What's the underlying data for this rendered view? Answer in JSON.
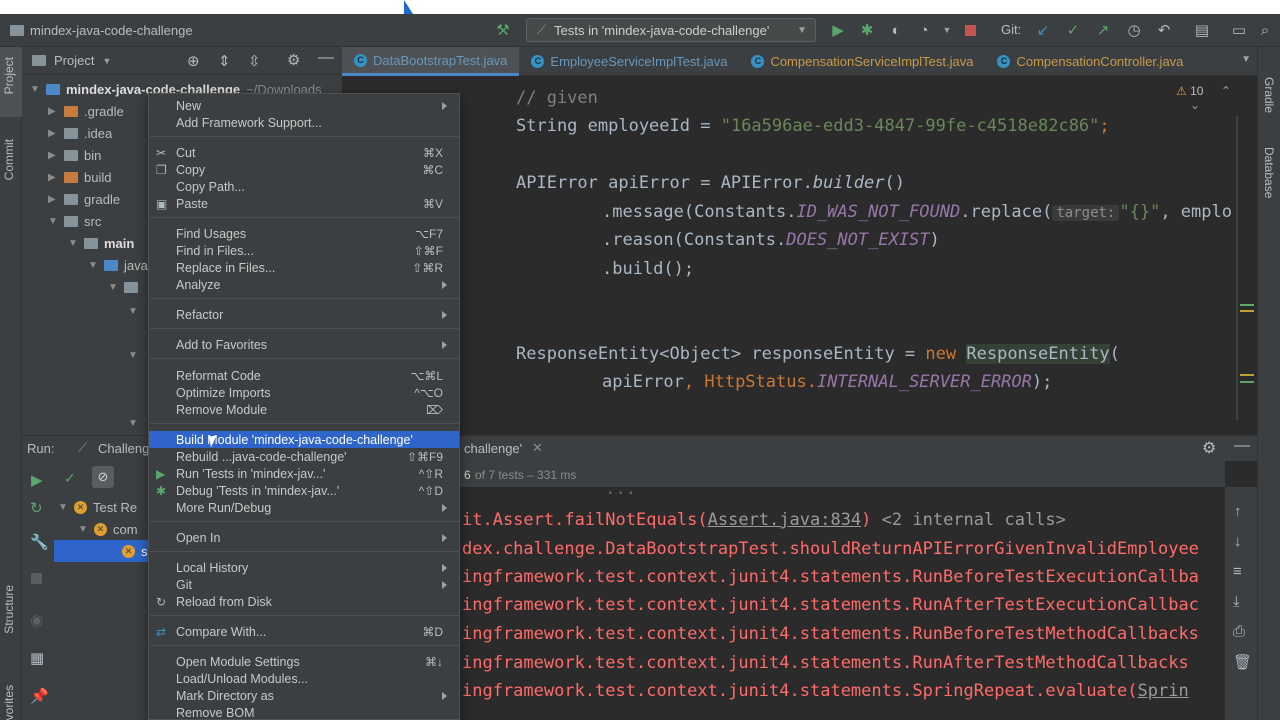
{
  "toolbar": {
    "project_name": "mindex-java-code-challenge",
    "run_config": "Tests in 'mindex-java-code-challenge'",
    "git_label": "Git:"
  },
  "left_strip": {
    "project": "Project",
    "commit": "Commit",
    "structure": "Structure",
    "favorites": "Favorites"
  },
  "right_strip": {
    "gradle": "Gradle",
    "database": "Database"
  },
  "project_panel": {
    "title": "Project",
    "root": "mindex-java-code-challenge",
    "root_path": "~/Downloads",
    "items": [
      ".gradle",
      ".idea",
      "bin",
      "build",
      "gradle",
      "src",
      "main",
      "java"
    ]
  },
  "tabs": [
    {
      "label": "DataBootstrapTest.java",
      "active": true
    },
    {
      "label": "EmployeeServiceImplTest.java",
      "active": false
    },
    {
      "label": "CompensationServiceImplTest.java",
      "active": false
    },
    {
      "label": "CompensationController.java",
      "active": false
    }
  ],
  "editor": {
    "warning_count": "10",
    "comment": "// given",
    "line1_type": "String employeeId = ",
    "line1_value": "\"16a596ae-edd3-4847-99fe-c4518e82c86\"",
    "line1_end": ";",
    "line2": "APIError apiError = APIError.",
    "line2_method": "builder",
    "line2_end": "()",
    "line3_a": ".message(Constants.",
    "line3_const": "ID_WAS_NOT_FOUND",
    "line3_b": ".replace(",
    "line3_hint": "target:",
    "line3_str": "\"{}\"",
    "line3_c": ", emplo",
    "line4_a": ".reason(Constants.",
    "line4_const": "DOES_NOT_EXIST",
    "line4_b": ")",
    "line5": ".build();",
    "line6_a": "ResponseEntity<Object> responseEntity = ",
    "line6_new": "new",
    "line6_b": "ResponseEntity",
    "line6_c": "(",
    "line7_a": "apiError",
    "line7_b": ", HttpStatus.",
    "line7_const": "INTERNAL_SERVER_ERROR",
    "line7_c": ");"
  },
  "run": {
    "label": "Run:",
    "config": "Challeng",
    "config_tail": "challenge'",
    "status_prefix": "6",
    "status_text": "of 7 tests – 331 ms",
    "tree_root": "Test Re",
    "tree_child": "com",
    "tree_leaf": "s",
    "console": [
      {
        "pre": "",
        "main": "it.Assert.failNotEquals(",
        "link": "Assert.java:834",
        "post": ")",
        "grey": " <2 internal calls>"
      },
      {
        "pre": "",
        "main": "dex.challenge.DataBootstrapTest.shouldReturnAPIErrorGivenInvalidEmployee",
        "link": "",
        "post": "",
        "grey": ""
      },
      {
        "pre": "",
        "main": "ingframework.test.context.junit4.statements.RunBeforeTestExecutionCallba",
        "link": "",
        "post": "",
        "grey": ""
      },
      {
        "pre": "",
        "main": "ingframework.test.context.junit4.statements.RunAfterTestExecutionCallbac",
        "link": "",
        "post": "",
        "grey": ""
      },
      {
        "pre": "",
        "main": "ingframework.test.context.junit4.statements.RunBeforeTestMethodCallbacks",
        "link": "",
        "post": "",
        "grey": ""
      },
      {
        "pre": "",
        "main": "ingframework.test.context.junit4.statements.RunAfterTestMethodCallbacks",
        "link": "",
        "post": "",
        "grey": ""
      },
      {
        "pre": "",
        "main": "ingframework.test.context.junit4.statements.SpringRepeat.evaluate(",
        "link": "Sprin",
        "post": "",
        "grey": ""
      }
    ]
  },
  "context_menu": {
    "items": [
      {
        "label": "New",
        "shortcut": "",
        "submenu": true,
        "icon": ""
      },
      {
        "label": "Add Framework Support...",
        "shortcut": "",
        "submenu": false,
        "icon": ""
      },
      {
        "label": "Cut",
        "shortcut": "⌘X",
        "submenu": false,
        "icon": "scissors-icon"
      },
      {
        "label": "Copy",
        "shortcut": "⌘C",
        "submenu": false,
        "icon": "copy-icon"
      },
      {
        "label": "Copy Path...",
        "shortcut": "",
        "submenu": false,
        "icon": ""
      },
      {
        "label": "Paste",
        "shortcut": "⌘V",
        "submenu": false,
        "icon": "paste-icon"
      },
      {
        "label": "Find Usages",
        "shortcut": "⌥F7",
        "submenu": false,
        "icon": ""
      },
      {
        "label": "Find in Files...",
        "shortcut": "⇧⌘F",
        "submenu": false,
        "icon": ""
      },
      {
        "label": "Replace in Files...",
        "shortcut": "⇧⌘R",
        "submenu": false,
        "icon": ""
      },
      {
        "label": "Analyze",
        "shortcut": "",
        "submenu": true,
        "icon": ""
      },
      {
        "label": "Refactor",
        "shortcut": "",
        "submenu": true,
        "icon": ""
      },
      {
        "label": "Add to Favorites",
        "shortcut": "",
        "submenu": true,
        "icon": ""
      },
      {
        "label": "Reformat Code",
        "shortcut": "⌥⌘L",
        "submenu": false,
        "icon": ""
      },
      {
        "label": "Optimize Imports",
        "shortcut": "^⌥O",
        "submenu": false,
        "icon": ""
      },
      {
        "label": "Remove Module",
        "shortcut": "⌦",
        "submenu": false,
        "icon": ""
      },
      {
        "label": "Build Module 'mindex-java-code-challenge'",
        "shortcut": "",
        "submenu": false,
        "icon": "",
        "selected": true
      },
      {
        "label": "Rebuild ...java-code-challenge'",
        "shortcut": "⇧⌘F9",
        "submenu": false,
        "icon": ""
      },
      {
        "label": "Run 'Tests in 'mindex-jav...'",
        "shortcut": "^⇧R",
        "submenu": false,
        "icon": "run-icon"
      },
      {
        "label": "Debug 'Tests in 'mindex-jav...'",
        "shortcut": "^⇧D",
        "submenu": false,
        "icon": "debug-icon"
      },
      {
        "label": "More Run/Debug",
        "shortcut": "",
        "submenu": true,
        "icon": ""
      },
      {
        "label": "Open In",
        "shortcut": "",
        "submenu": true,
        "icon": ""
      },
      {
        "label": "Local History",
        "shortcut": "",
        "submenu": true,
        "icon": ""
      },
      {
        "label": "Git",
        "shortcut": "",
        "submenu": true,
        "icon": ""
      },
      {
        "label": "Reload from Disk",
        "shortcut": "",
        "submenu": false,
        "icon": "reload-icon"
      },
      {
        "label": "Compare With...",
        "shortcut": "⌘D",
        "submenu": false,
        "icon": "compare-icon"
      },
      {
        "label": "Open Module Settings",
        "shortcut": "⌘↓",
        "submenu": false,
        "icon": ""
      },
      {
        "label": "Load/Unload Modules...",
        "shortcut": "",
        "submenu": false,
        "icon": ""
      },
      {
        "label": "Mark Directory as",
        "shortcut": "",
        "submenu": true,
        "icon": ""
      },
      {
        "label": "Remove BOM",
        "shortcut": "",
        "submenu": false,
        "icon": ""
      }
    ]
  }
}
